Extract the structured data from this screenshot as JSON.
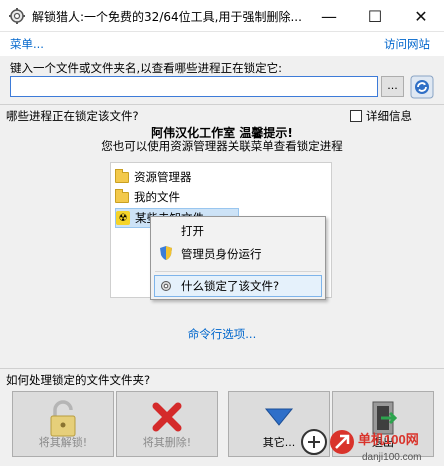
{
  "window": {
    "title": "解锁猎人:一个免费的32/64位工具,用于强制删除...",
    "minimize_glyph": "—",
    "maximize_glyph": "☐",
    "close_glyph": "✕"
  },
  "menubar": {
    "menu_label": "菜单...",
    "site_label": "访问网站"
  },
  "input_section": {
    "prompt": "键入一个文件或文件夹名,以查看哪些进程正在锁定它:",
    "path_value": "",
    "browse_label": "...",
    "refresh_icon": "refresh-icon"
  },
  "locking_section": {
    "label": "哪些进程正在锁定该文件?",
    "detail_label": "详细信息",
    "detail_checked": false
  },
  "tip": {
    "title": "阿伟汉化工作室 温馨提示!",
    "subtitle": "您也可以使用资源管理器关联菜单查看锁定进程"
  },
  "explorer_preview": {
    "items": [
      "资源管理器",
      "我的文件",
      "某些未知文件"
    ],
    "context_menu": [
      "打开",
      "管理员身份运行",
      "什么锁定了该文件?"
    ]
  },
  "cmdline_link": "命令行选项...",
  "actions": {
    "label": "如何处理锁定的文件文件夹?",
    "unlock_label": "将其解锁!",
    "delete_label": "将其删除!",
    "other_label": "其它...",
    "exit_label": "退出"
  },
  "watermark": {
    "brand": "单机100网",
    "url": "danji100.com"
  },
  "colors": {
    "accent": "#0066cc",
    "input_border": "#3d7bd8",
    "delete_red": "#d42a2a",
    "brand_red": "#d9332b"
  }
}
